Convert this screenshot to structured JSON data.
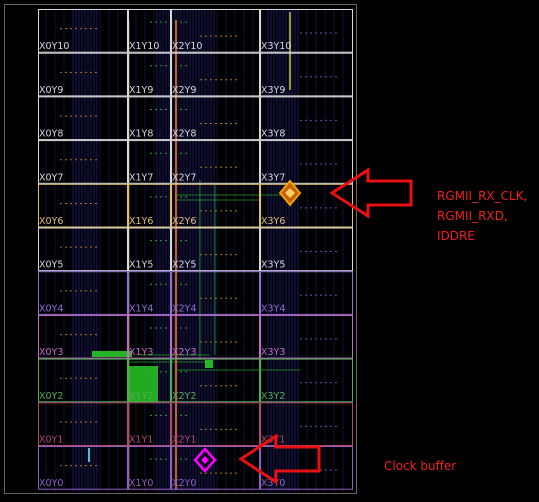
{
  "device_view": {
    "columns": [
      "X0",
      "X1",
      "X2",
      "X3"
    ],
    "rows": [
      {
        "y": "Y10",
        "labels": [
          "X0Y10",
          "X1Y10",
          "X2Y10",
          "X3Y10"
        ],
        "color": "#d8d8d8"
      },
      {
        "y": "Y9",
        "labels": [
          "X0Y9",
          "X1Y9",
          "X2Y9",
          "X3Y9"
        ],
        "color": "#d8d8d8"
      },
      {
        "y": "Y8",
        "labels": [
          "X0Y8",
          "X1Y8",
          "X2Y8",
          "X3Y8"
        ],
        "color": "#d8d8d8"
      },
      {
        "y": "Y7",
        "labels": [
          "X0Y7",
          "X1Y7",
          "X2Y7",
          "X3Y7"
        ],
        "color": "#d8d8d8"
      },
      {
        "y": "Y6",
        "labels": [
          "X0Y6",
          "X1Y6",
          "X2Y6",
          "X3Y6"
        ],
        "color": "#e0c070"
      },
      {
        "y": "Y5",
        "labels": [
          "X0Y5",
          "X1Y5",
          "X2Y5",
          "X3Y5"
        ],
        "color": "#d8d8d8"
      },
      {
        "y": "Y4",
        "labels": [
          "X0Y4",
          "X1Y4",
          "X2Y4",
          "X3Y4"
        ],
        "color": "#9070d0"
      },
      {
        "y": "Y3",
        "labels": [
          "X0Y3",
          "X1Y3",
          "X2Y3",
          "X3Y3"
        ],
        "color": "#c070c0"
      },
      {
        "y": "Y2",
        "labels": [
          "X0Y2",
          "X1Y2",
          "X2Y2",
          "X3Y2"
        ],
        "color": "#50b050"
      },
      {
        "y": "Y1",
        "labels": [
          "X0Y1",
          "X1Y1",
          "X2Y1",
          "X3Y1"
        ],
        "color": "#b04a70"
      },
      {
        "y": "Y0",
        "labels": [
          "X0Y0",
          "X1Y0",
          "X2Y0",
          "X3Y0"
        ],
        "color": "#9060c0"
      }
    ],
    "markers": {
      "rgmii_color": "#f0a000",
      "clock_buffer_color": "#ff00ff",
      "arrow_color": "#e81010",
      "routing_color": "#28c828"
    }
  },
  "annotations": {
    "rgmii_lines": [
      "RGMII_RX_CLK,",
      "RGMII_RXD,",
      "IDDRE"
    ],
    "clock_buffer": "Clock buffer"
  }
}
